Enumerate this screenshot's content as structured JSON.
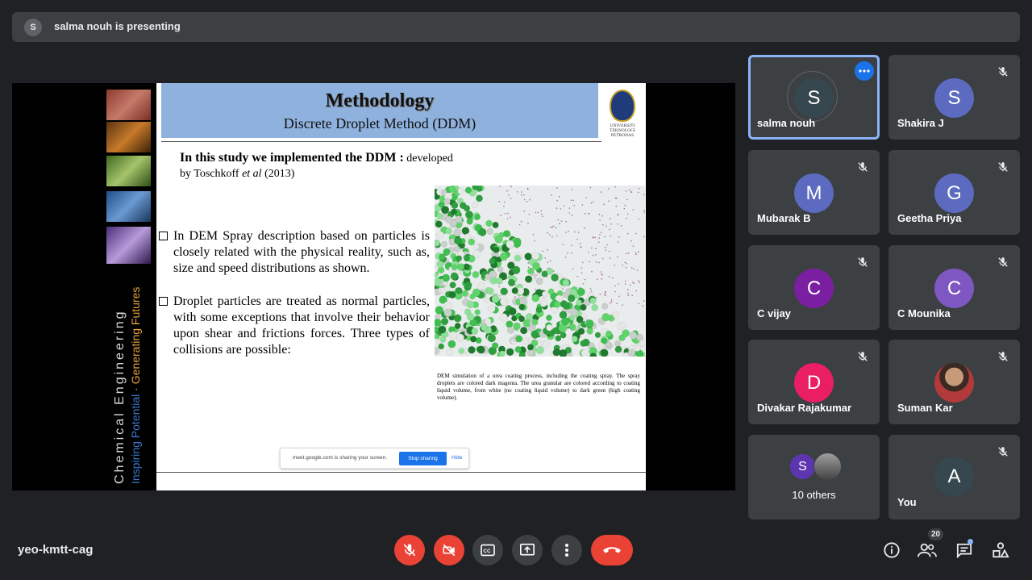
{
  "meeting": {
    "presenter_initial": "S",
    "presenting_text": "salma nouh is presenting",
    "code": "yeo-kmtt-cag",
    "participant_count": "20"
  },
  "slide": {
    "title": "Methodology",
    "subtitle": "Discrete Droplet Method (DDM)",
    "logo_text_1": "UNIVERSITI",
    "logo_text_2": "TEKNOLOGI",
    "logo_text_3": "PETRONAS",
    "intro_bold": "In this study we implemented the DDM :",
    "intro_rest": " developed",
    "intro_line2_a": "by Toschkoff ",
    "intro_line2_italic": "et al",
    "intro_line2_b": " (2013)",
    "bullet1": "In DEM Spray description based on particles is closely related with the physical reality, such as, size and speed distributions as shown.",
    "bullet2": "Droplet particles are treated as normal particles, with some exceptions that involve their behavior upon shear and frictions forces. Three types of collisions are possible:",
    "caption": "DEM simulation of a urea coating process, including the coating spray. The spray droplets are colored dark magenta. The urea granular are colored according to coating liquid volume, from white (no coating liquid volume) to dark green (high coating volume).",
    "side_line1": "Chemical Engineering",
    "side_line2a": "Inspiring Potential",
    "side_line2sep": " · ",
    "side_line2b": "Generating Futures"
  },
  "share_toast": {
    "message": "meet.google.com is sharing your screen.",
    "stop_label": "Stop sharing",
    "hide_label": "Hide"
  },
  "participants": [
    {
      "initial": "S",
      "name": "salma nouh",
      "color": "#37474f"
    },
    {
      "initial": "S",
      "name": "Shakira J",
      "color": "#5c6bc0"
    },
    {
      "initial": "M",
      "name": "Mubarak B",
      "color": "#5c6bc0"
    },
    {
      "initial": "G",
      "name": "Geetha Priya",
      "color": "#5c6bc0"
    },
    {
      "initial": "C",
      "name": "C vijay",
      "color": "#7b1fa2"
    },
    {
      "initial": "C",
      "name": "C Mounika",
      "color": "#7e57c2"
    },
    {
      "initial": "D",
      "name": "Divakar Rajakumar",
      "color": "#e91e63"
    },
    {
      "initial": "",
      "name": "Suman Kar",
      "color": "#5d4037"
    },
    {
      "initial": "S",
      "name": "10 others",
      "color": "#5e35b1"
    },
    {
      "initial": "A",
      "name": "You",
      "color": "#37474f"
    }
  ],
  "colors": {
    "background": "#202124",
    "tile": "#3c4043",
    "accent": "#1a73e8",
    "active_border": "#8ab4f8",
    "danger": "#ea4335"
  },
  "icons": {
    "mute": "mic-off-icon",
    "more": "more-horiz-icon",
    "camera_off": "camera-off-icon",
    "captions": "captions-icon",
    "present": "present-screen-icon",
    "more_vert": "more-vert-icon",
    "hangup": "call-end-icon",
    "info": "info-icon",
    "people": "people-icon",
    "chat": "chat-icon",
    "activities": "activities-icon"
  }
}
